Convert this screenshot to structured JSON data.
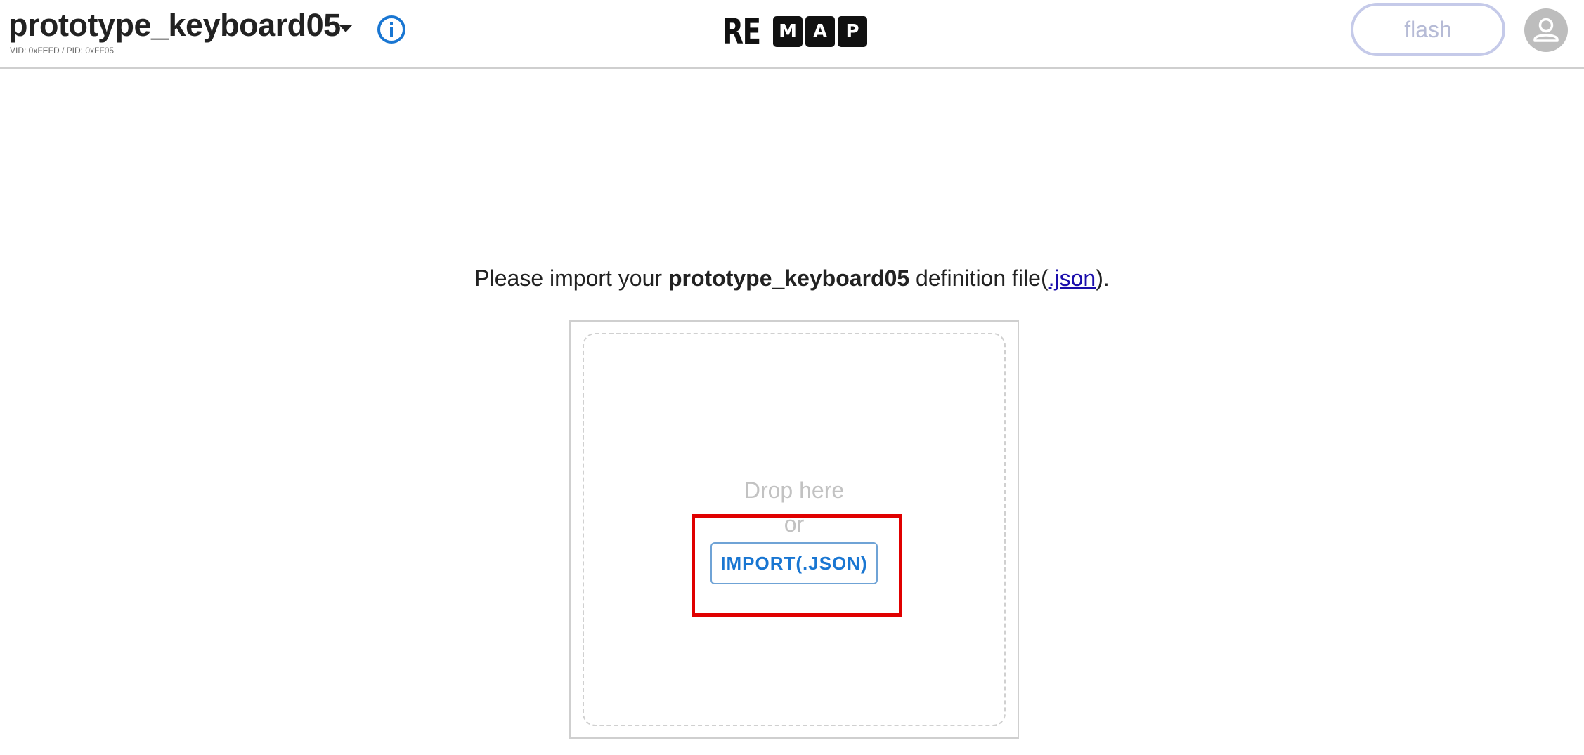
{
  "header": {
    "keyboard_name": "prototype_keyboard05",
    "vid_pid": "VID: 0xFEFD / PID: 0xFF05",
    "logo": {
      "prefix": "RE",
      "boxed_letters": [
        "M",
        "A",
        "P"
      ]
    },
    "flash_label": "flash",
    "info_icon": "info-circle-icon",
    "avatar_icon": "person-icon"
  },
  "main": {
    "prompt_before": "Please import your ",
    "prompt_keyboard": "prototype_keyboard05",
    "prompt_middle": " definition file(",
    "prompt_link": ".json",
    "prompt_after": ").",
    "drop_here": "Drop here",
    "or": "or",
    "import_label": "IMPORT(.JSON)"
  },
  "colors": {
    "accent": "#1976d2",
    "flash_border": "#c5cae9",
    "highlight": "#e00000",
    "link": "#1a0dab"
  }
}
